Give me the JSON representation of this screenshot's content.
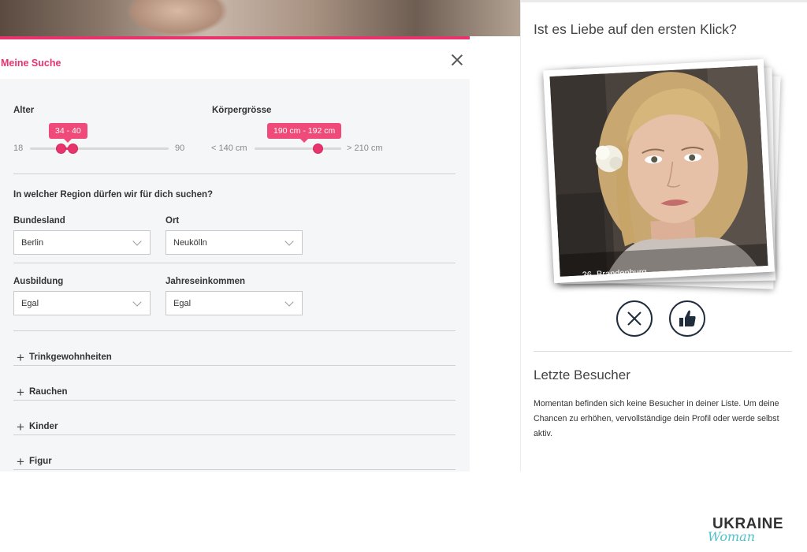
{
  "search": {
    "title": "Meine Suche",
    "age": {
      "label": "Alter",
      "min_label": "18",
      "max_label": "90",
      "range_label": "34 - 40",
      "min": 18,
      "max": 90,
      "value_low": 34,
      "value_high": 40
    },
    "height": {
      "label": "Körpergrösse",
      "min_label": "< 140 cm",
      "max_label": "> 210 cm",
      "range_label": "190 cm - 192 cm",
      "min": 140,
      "max": 210,
      "value_low": 190,
      "value_high": 192
    },
    "region_question": "In welcher Region dürfen wir für dich suchen?",
    "bundesland": {
      "label": "Bundesland",
      "value": "Berlin"
    },
    "ort": {
      "label": "Ort",
      "value": "Neukölln"
    },
    "ausbildung": {
      "label": "Ausbildung",
      "value": "Egal"
    },
    "einkommen": {
      "label": "Jahreseinkommen",
      "value": "Egal"
    },
    "accordion": [
      "Trinkgewohnheiten",
      "Rauchen",
      "Kinder",
      "Figur"
    ]
  },
  "match": {
    "title": "Ist es Liebe auf den ersten Klick?",
    "caption": "36, Brandenburg"
  },
  "visitors": {
    "title": "Letzte Besucher",
    "text": "Momentan befinden sich keine Besucher in deiner Liste. Um deine Chancen zu erhöhen, vervollständige dein Profil oder werde selbst aktiv."
  },
  "logo": {
    "line1": "UKRAINE",
    "line2": "Woman"
  },
  "colors": {
    "accent": "#e8336d",
    "dark": "#1f2d3d",
    "logo_teal": "#4fc1c9"
  }
}
